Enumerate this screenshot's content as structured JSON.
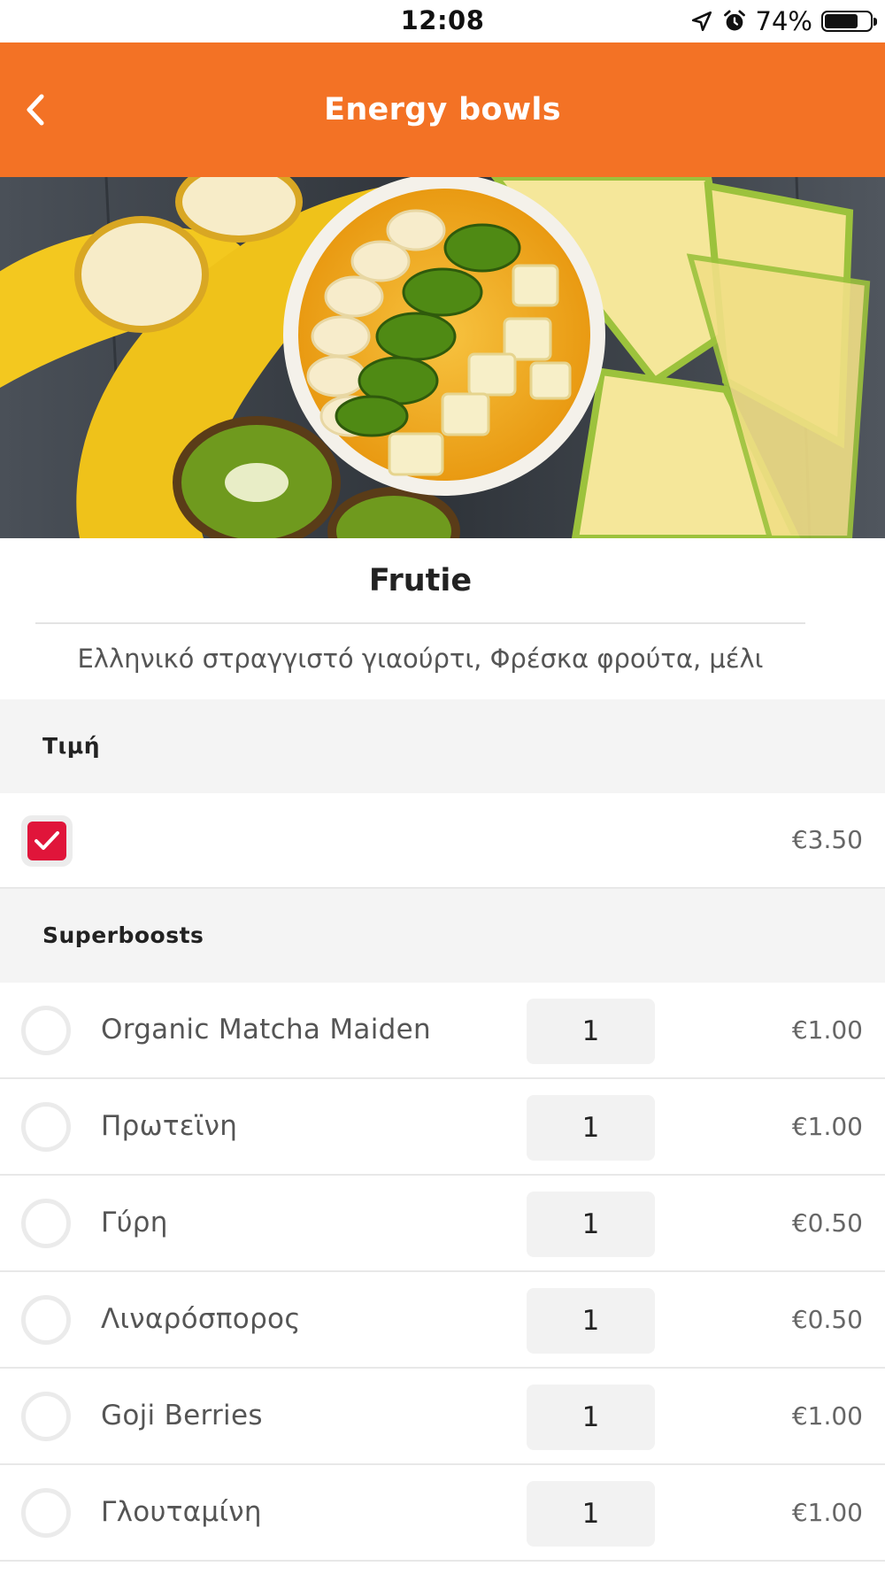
{
  "status_bar": {
    "time": "12:08",
    "battery_percent": "74%",
    "battery_level": 0.74,
    "icons": [
      "location-arrow-icon",
      "alarm-clock-icon",
      "battery-icon"
    ]
  },
  "header": {
    "title": "Energy bowls",
    "background_color": "#f37225",
    "back_icon": "chevron-left-icon"
  },
  "product": {
    "name": "Frutie",
    "description": "Ελληνικό στραγγιστό γιαούρτι, Φρέσκα φρούτα, μέλι"
  },
  "price_section": {
    "title": "Τιμή",
    "checked": true,
    "price": "€3.50",
    "check_color": "#e0153a"
  },
  "superboosts": {
    "title": "Superboosts",
    "items": [
      {
        "name": "Organic Matcha Maiden",
        "qty": "1",
        "price": "€1.00",
        "selected": false
      },
      {
        "name": "Πρωτεϊνη",
        "qty": "1",
        "price": "€1.00",
        "selected": false
      },
      {
        "name": "Γύρη",
        "qty": "1",
        "price": "€0.50",
        "selected": false
      },
      {
        "name": "Λιναρόσπορος",
        "qty": "1",
        "price": "€0.50",
        "selected": false
      },
      {
        "name": "Goji Berries",
        "qty": "1",
        "price": "€1.00",
        "selected": false
      },
      {
        "name": "Γλουταμίνη",
        "qty": "1",
        "price": "€1.00",
        "selected": false
      }
    ]
  }
}
